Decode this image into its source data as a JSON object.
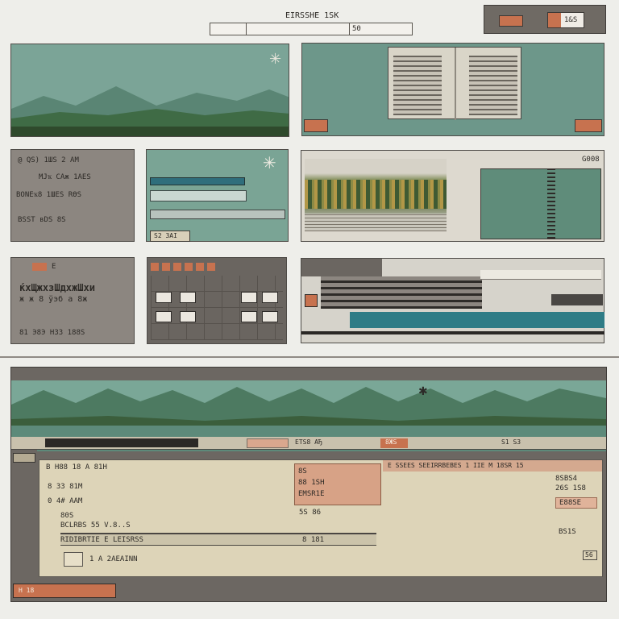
{
  "header": {
    "title": "EIRSSHE 1SK",
    "search_value": "50",
    "topright_label": "1&S"
  },
  "panels": {
    "text_panel_1": {
      "rows": [
        "@  QS) 1ШS 2 AM",
        "MJҡ  CAж  1AES",
        "BONEҡ8  1ШES  RӨS",
        "BSSТ  вDS  8S"
      ]
    },
    "text_panel_2": {
      "tag": "E",
      "row1": "ќхЩжхзШдхжШхи",
      "row2": "ж ж 8 ўэб а 8ж",
      "row3": "81  Э8Э   H33 188S"
    },
    "teal_panel_btn": "S2 3AI",
    "right_top_label": "G008"
  },
  "bottom": {
    "toolbar_label_1": "EТS8  AЂ",
    "toolbar_label_2": "8ЖS",
    "toolbar_label_3": "S1  S3",
    "form_title": "B H88  18  A 81H",
    "rows": [
      "8  33  81M",
      "0  4#  AAM",
      "80S",
      "BCLRBS 55 V.8..S",
      "RIDIBRTIE  E LEISRSS",
      "1 A 2AEAINN"
    ],
    "field_label": "5S 86",
    "field_label2": "8 181",
    "orange_card": [
      "8S",
      "88 1SH",
      "EMSR1E"
    ],
    "right_header": "E SSEES  SEEIRRBEBES 1 IIE  M 18SR 15",
    "right_items": [
      "8SBS4",
      "26S  1S8",
      "E88SE"
    ],
    "right_bottom": "BS1S",
    "page_box": "56",
    "bottom_btn": "H 18"
  }
}
